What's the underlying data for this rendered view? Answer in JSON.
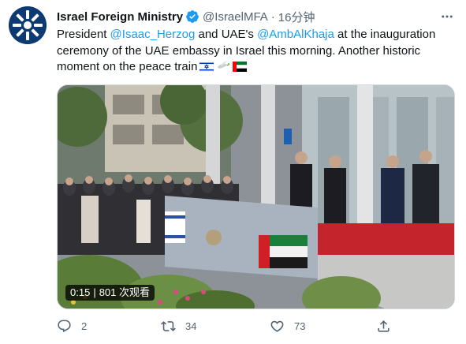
{
  "tweet": {
    "author": {
      "name": "Israel Foreign Ministry",
      "handle": "@IsraelMFA",
      "verified": true
    },
    "time": "16分钟",
    "text": {
      "line1": {
        "a": "President ",
        "mention1": "@Isaac_Herzog",
        "b": " and UAE's ",
        "mention2": "@AmbAlKhaja",
        "c": " at the inauguration"
      },
      "line2": "ceremony of the UAE embassy in Israel this morning. Another historic",
      "line3": "moment on the peace train"
    },
    "emoji": [
      "israel-flag",
      "dove-olive-branch",
      "uae-flag"
    ],
    "video": {
      "duration": "0:15",
      "views": "801 次观看"
    },
    "actions": {
      "replies": "2",
      "retweets": "34",
      "likes": "73"
    }
  },
  "colors": {
    "accent": "#1d9bf0",
    "text": "#0f1419",
    "secondary": "#536471",
    "avatar_bg": "#0e3a73"
  }
}
